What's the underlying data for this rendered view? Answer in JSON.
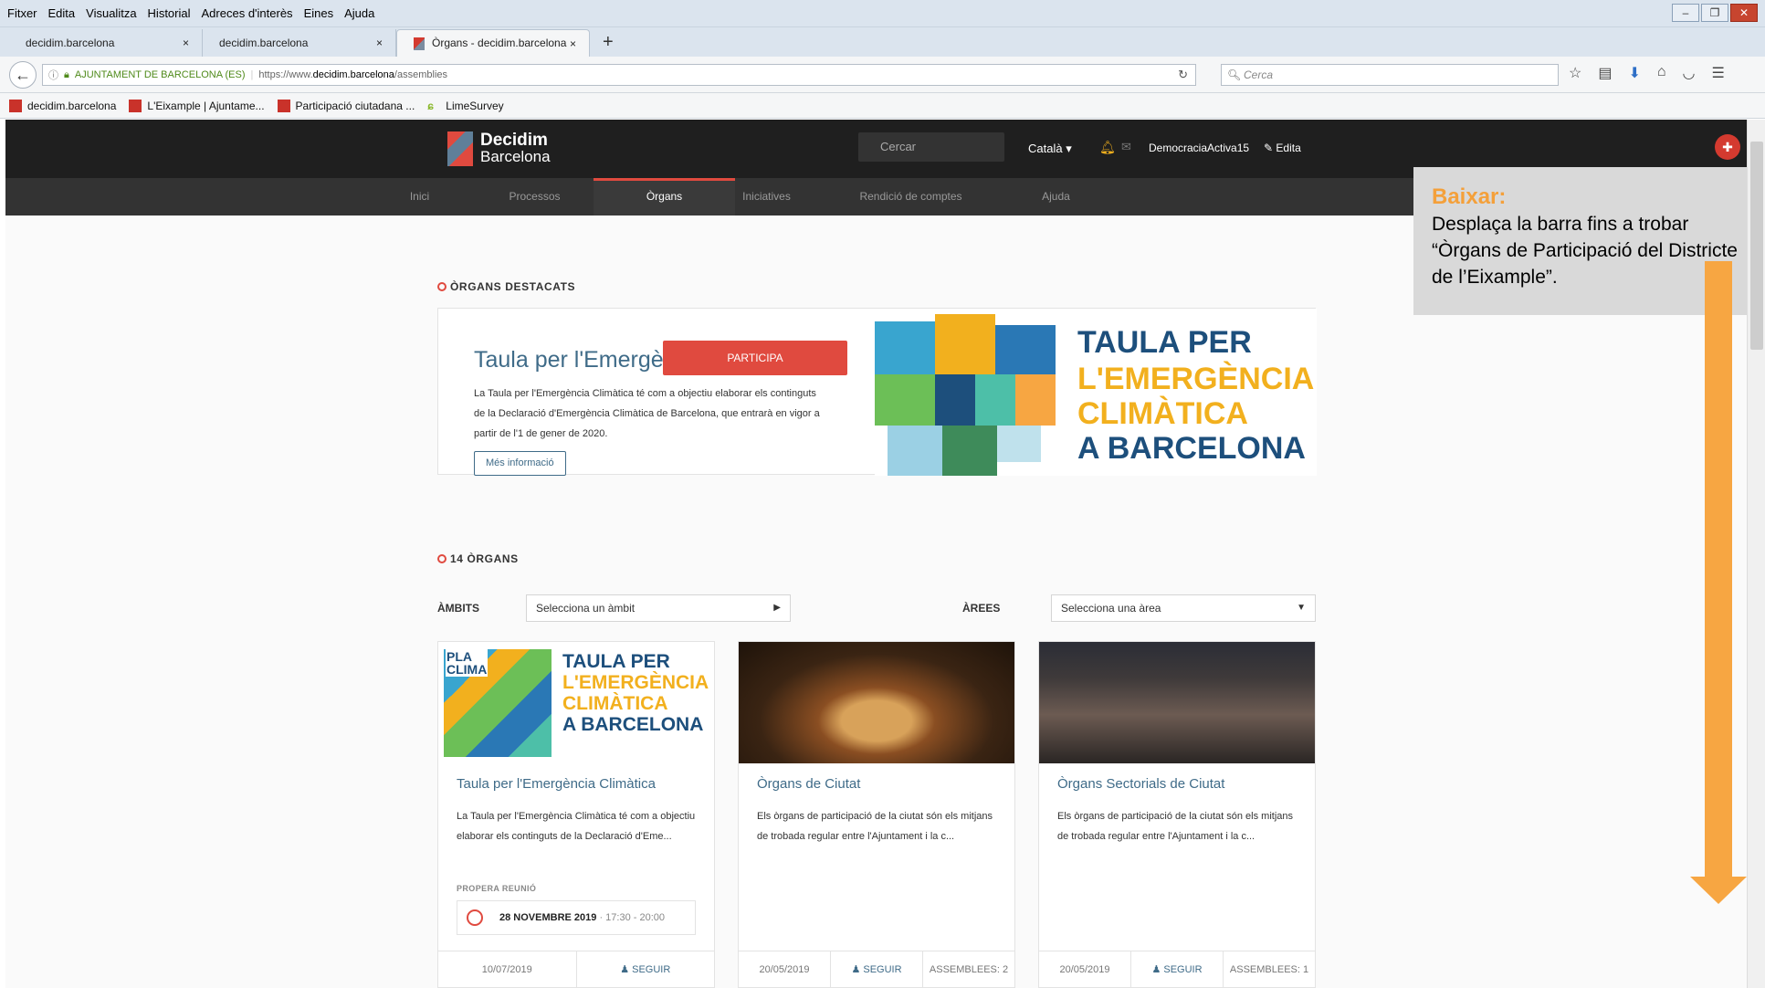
{
  "menu": [
    "Fitxer",
    "Edita",
    "Visualitza",
    "Historial",
    "Adreces d'interès",
    "Eines",
    "Ajuda"
  ],
  "tabs": [
    {
      "label": "decidim.barcelona"
    },
    {
      "label": "decidim.barcelona"
    },
    {
      "label": "Òrgans - decidim.barcelona"
    }
  ],
  "address": {
    "site": "AJUNTAMENT DE BARCELONA (ES)",
    "prefix": "https://www.",
    "domain": "decidim.barcelona",
    "path": "/assemblies"
  },
  "search_placeholder": "Cerca",
  "bookmarks": [
    "decidim.barcelona",
    "L'Eixample | Ajuntame...",
    "Participació ciutadana ...",
    "LimeSurvey"
  ],
  "site": {
    "logo_line1": "Decidim",
    "logo_line2": "Barcelona",
    "search": "Cercar",
    "language": "Català ▾",
    "user": "DemocraciaActiva15",
    "edit": "✎ Edita",
    "nav": [
      "Inici",
      "Processos",
      "Òrgans",
      "Iniciatives",
      "Rendició de comptes",
      "Ajuda"
    ]
  },
  "featured": {
    "section": "ÒRGANS DESTACATS",
    "title": "Taula per l'Emergència Climàtica",
    "body": "La Taula per l'Emergència Climàtica té com a objectiu elaborar els continguts de la Declaració d'Emergència Climàtica de Barcelona, que entrarà en vigor a partir de l'1 de gener de 2020.",
    "more": "Més informació",
    "banner": [
      "TAULA PER",
      "L'EMERGÈNCIA",
      "CLIMÀTICA",
      "A BARCELONA"
    ],
    "participa": "PARTICIPA"
  },
  "list": {
    "section": "14 ÒRGANS",
    "ambits_label": "ÀMBITS",
    "ambits_value": "Selecciona un àmbit",
    "arees_label": "ÀREES",
    "arees_value": "Selecciona una àrea"
  },
  "cards": [
    {
      "title": "Taula per l'Emergència Climàtica",
      "body": "La Taula per l'Emergència Climàtica té com a objectiu elaborar els continguts de la Declaració d'Eme...",
      "meeting_label": "PROPERA REUNIÓ",
      "meeting_date": "28 NOVEMBRE 2019",
      "meeting_time": "· 17:30 - 20:00",
      "date": "10/07/2019",
      "follow": "♟ SEGUIR",
      "banner": [
        "PLA",
        "CLIMA",
        "TAULA PER",
        "L'EMERGÈNCIA",
        "CLIMÀTICA",
        "A BARCELONA"
      ]
    },
    {
      "title": "Òrgans de Ciutat",
      "body": "Els òrgans de participació de la ciutat són els mitjans de trobada regular entre l'Ajuntament i la c...",
      "date": "20/05/2019",
      "follow": "♟ SEGUIR",
      "count": "ASSEMBLEES: 2"
    },
    {
      "title": "Òrgans Sectorials de Ciutat",
      "body": "Els òrgans de participació de la ciutat són els mitjans de trobada regular entre l'Ajuntament i la c...",
      "date": "20/05/2019",
      "follow": "♟ SEGUIR",
      "count": "ASSEMBLEES: 1"
    }
  ],
  "overlay": {
    "title": "Baixar:",
    "text": "Desplaça la barra fins a trobar “Òrgans de Participació del Districte de l’Eixample”."
  },
  "colors": {
    "accent": "#e04a3f",
    "link": "#3f6b88",
    "arrow": "#f7a642",
    "topbar": "#1f1f1f"
  }
}
